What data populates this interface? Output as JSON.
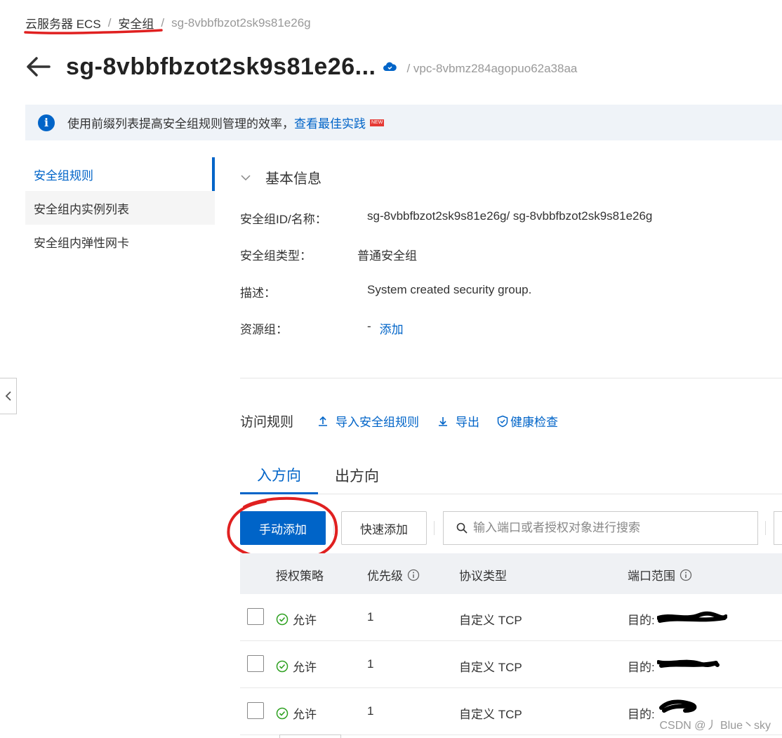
{
  "breadcrumb": {
    "item1": "云服务器 ECS",
    "sep": "/",
    "item2": "安全组",
    "current": "sg-8vbbfbzot2sk9s81e26g"
  },
  "header": {
    "title": "sg-8vbbfbzot2sk9s81e26...",
    "vpc": "/ vpc-8vbmz284agopuo62a38aa"
  },
  "notice": {
    "text": "使用前缀列表提高安全组规则管理的效率，",
    "link": "查看最佳实践",
    "badge": "NEW"
  },
  "sidenav": {
    "items": [
      {
        "label": "安全组规则",
        "active": true
      },
      {
        "label": "安全组内实例列表",
        "active": false
      },
      {
        "label": "安全组内弹性网卡",
        "active": false
      }
    ]
  },
  "basic_info": {
    "title": "基本信息",
    "rows": [
      {
        "key": "安全组ID/名称：",
        "value": "sg-8vbbfbzot2sk9s81e26g/ sg-8vbbfbzot2sk9s81e26g"
      },
      {
        "key": "安全组类型：",
        "value": "普通安全组"
      },
      {
        "key": "描述：",
        "value": "System created security group."
      },
      {
        "key": "资源组：",
        "value": "-",
        "link": "添加"
      }
    ]
  },
  "rules": {
    "title": "访问规则",
    "actions": [
      "导入安全组规则",
      "导出",
      "健康检查"
    ],
    "tabs": [
      "入方向",
      "出方向"
    ],
    "manual_add": "手动添加",
    "quick_add": "快速添加",
    "search_placeholder": "输入端口或者授权对象进行搜索",
    "columns": [
      "授权策略",
      "优先级",
      "协议类型",
      "端口范围"
    ],
    "rows": [
      {
        "policy": "允许",
        "priority": "1",
        "protocol": "自定义 TCP",
        "port": "目的:"
      },
      {
        "policy": "允许",
        "priority": "1",
        "protocol": "自定义 TCP",
        "port": "目的:"
      },
      {
        "policy": "允许",
        "priority": "1",
        "protocol": "自定义 TCP",
        "port": "目的:"
      }
    ]
  },
  "watermark": "CSDN @丿 Blue丶sky",
  "colors": {
    "accent": "#0064c8",
    "success": "#2ea121",
    "annotation_red": "#e02020"
  }
}
